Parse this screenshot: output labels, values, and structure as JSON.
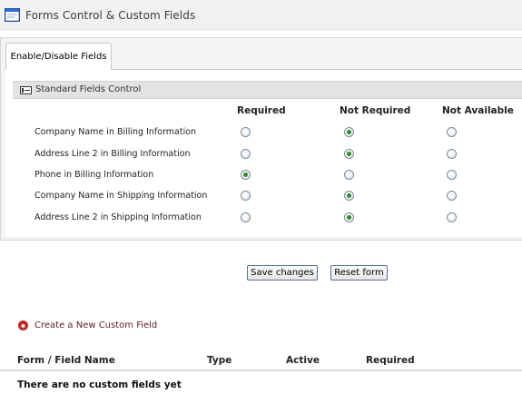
{
  "header": {
    "title": "Forms Control & Custom Fields",
    "icon": "window-icon"
  },
  "tabs": [
    {
      "label": "Enable/Disable Fields",
      "active": true
    }
  ],
  "section": {
    "title": "Standard Fields Control",
    "icon": "form-field-icon"
  },
  "columns": [
    "Required",
    "Not Required",
    "Not Available"
  ],
  "rows": [
    {
      "label": "Company Name in Billing Information",
      "selected": "Not Required"
    },
    {
      "label": "Address Line 2 in Billing Information",
      "selected": "Not Required"
    },
    {
      "label": "Phone in Billing Information",
      "selected": "Required"
    },
    {
      "label": "Company Name in Shipping Information",
      "selected": "Not Required"
    },
    {
      "label": "Address Line 2 in Shipping Information",
      "selected": "Not Required"
    }
  ],
  "buttons": {
    "save": "Save changes",
    "reset": "Reset form"
  },
  "custom_fields": {
    "create_link": "Create a New Custom Field",
    "create_icon": "add-field-icon",
    "headers": [
      "Form / Field Name",
      "Type",
      "Active",
      "Required"
    ],
    "empty_message": "There are no custom fields yet"
  },
  "colors": {
    "radio_selected": "#2e8a2e",
    "link": "#5a1f1f",
    "header_bg": "#f1f1f1"
  }
}
